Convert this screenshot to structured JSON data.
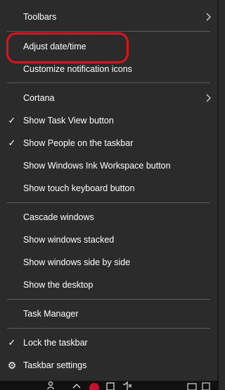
{
  "menu": {
    "items": [
      {
        "label": "Toolbars"
      },
      {
        "label": "Adjust date/time"
      },
      {
        "label": "Customize notification icons"
      },
      {
        "label": "Cortana"
      },
      {
        "label": "Show Task View button",
        "checked": true
      },
      {
        "label": "Show People on the taskbar",
        "checked": true
      },
      {
        "label": "Show Windows Ink Workspace button"
      },
      {
        "label": "Show touch keyboard button"
      },
      {
        "label": "Cascade windows"
      },
      {
        "label": "Show windows stacked"
      },
      {
        "label": "Show windows side by side"
      },
      {
        "label": "Show the desktop"
      },
      {
        "label": "Task Manager"
      },
      {
        "label": "Lock the taskbar",
        "checked": true
      },
      {
        "label": "Taskbar settings"
      }
    ],
    "check_glyph": "✓",
    "submenu_glyph": "›",
    "settings_glyph": "⚙"
  },
  "highlight": {
    "color": "#e0101e",
    "target": "Adjust date/time"
  },
  "colors": {
    "menu_bg": "#2b2b2b",
    "text": "#ffffff",
    "separator": "#5a5a5a"
  }
}
